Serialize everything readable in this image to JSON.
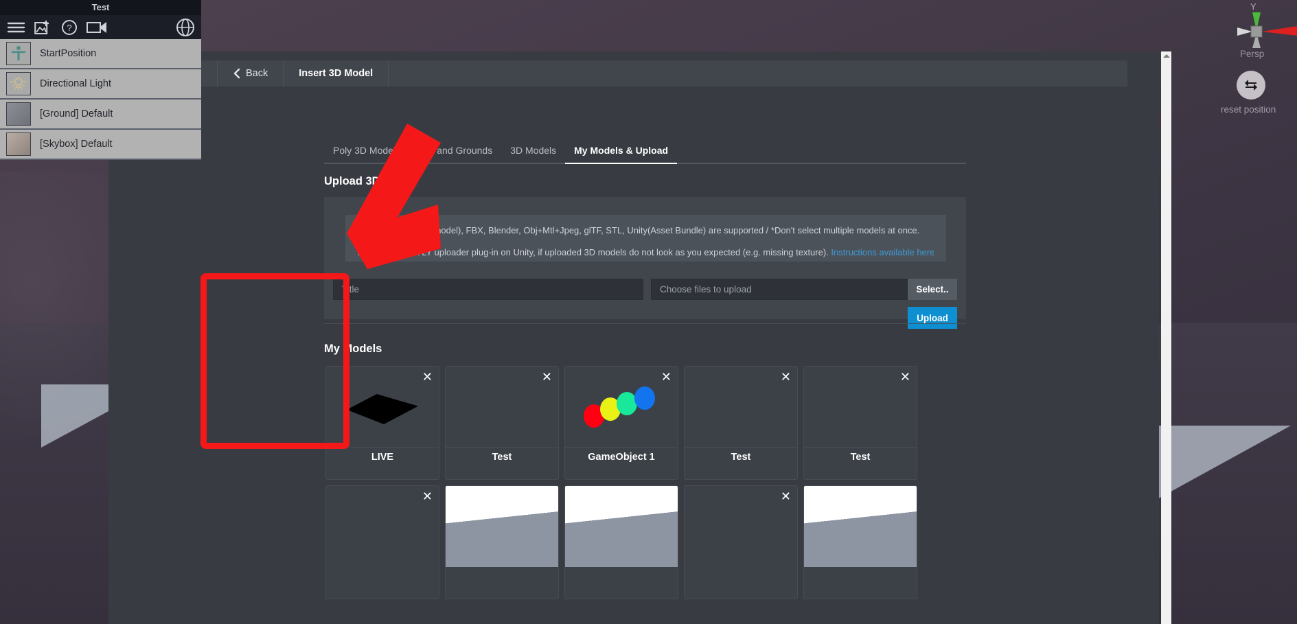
{
  "viewport": {
    "gizmo": {
      "y_label": "Y",
      "projection_label": "Persp",
      "reset_label": "reset position",
      "reset_icon": "reset-arrow-icon"
    }
  },
  "hierarchy_panel": {
    "title": "Test",
    "toolbar": [
      {
        "name": "menu-icon",
        "label": "Menu"
      },
      {
        "name": "add-image-icon",
        "label": "Add Image"
      },
      {
        "name": "help-icon",
        "label": "Help"
      },
      {
        "name": "camera-icon",
        "label": "Camera"
      },
      {
        "name": "globe-icon",
        "label": "Publish"
      }
    ],
    "items": [
      {
        "label": "StartPosition",
        "thumb": "avatar-icon"
      },
      {
        "label": "Directional Light",
        "thumb": "light-icon"
      },
      {
        "label": "[Ground] Default",
        "thumb": "ground-texture"
      },
      {
        "label": "[Skybox] Default",
        "thumb": "skybox-texture"
      }
    ]
  },
  "modal": {
    "back_label": "Back",
    "title": "Insert 3D Model",
    "tabs": [
      {
        "label": "Poly 3D Models",
        "active": false
      },
      {
        "label": "Sky and Grounds",
        "active": false
      },
      {
        "label": "3D Models",
        "active": false
      },
      {
        "label": "My Models & Upload",
        "active": true
      }
    ],
    "upload": {
      "heading": "Upload 3D Model",
      "info_line_1": "SKP(2014 or 2015 model), FBX, Blender, Obj+Mtl+Jpeg, glTF, STL, Unity(Asset Bundle) are supported / *Don't select multiple models at once.",
      "info_line_2": "Please use STYLY uploader plug-in on Unity, if uploaded 3D models do not look as you expected (e.g. missing texture).",
      "info_link": "Instructions available here.",
      "title_placeholder": "Title",
      "title_value": "",
      "file_placeholder": "Choose files to upload",
      "file_value": "",
      "select_label": "Select..",
      "upload_label": "Upload"
    },
    "my_models": {
      "heading": "My Models",
      "close_icon": "close-icon",
      "cards": [
        {
          "name": "LIVE",
          "thumb": "black-plane"
        },
        {
          "name": "Test",
          "thumb": "empty"
        },
        {
          "name": "GameObject 1",
          "thumb": "color-balls"
        },
        {
          "name": "Test",
          "thumb": "empty"
        },
        {
          "name": "Test",
          "thumb": "empty"
        },
        {
          "name": "",
          "thumb": "empty"
        },
        {
          "name": "",
          "thumb": "white-slope"
        },
        {
          "name": "",
          "thumb": "white-slope"
        },
        {
          "name": "",
          "thumb": "empty"
        },
        {
          "name": "",
          "thumb": "white-slope"
        }
      ],
      "ball_colors": [
        "#ff0013",
        "#eaf215",
        "#17e89a",
        "#1274ef"
      ]
    }
  },
  "annotations": {
    "arrow": {
      "name": "red-arrow-annotation",
      "color": "#f41818"
    },
    "highlight_box": {
      "name": "red-highlight-box",
      "color": "#f41818"
    }
  },
  "scrollbar": {
    "name": "vertical-scrollbar"
  }
}
